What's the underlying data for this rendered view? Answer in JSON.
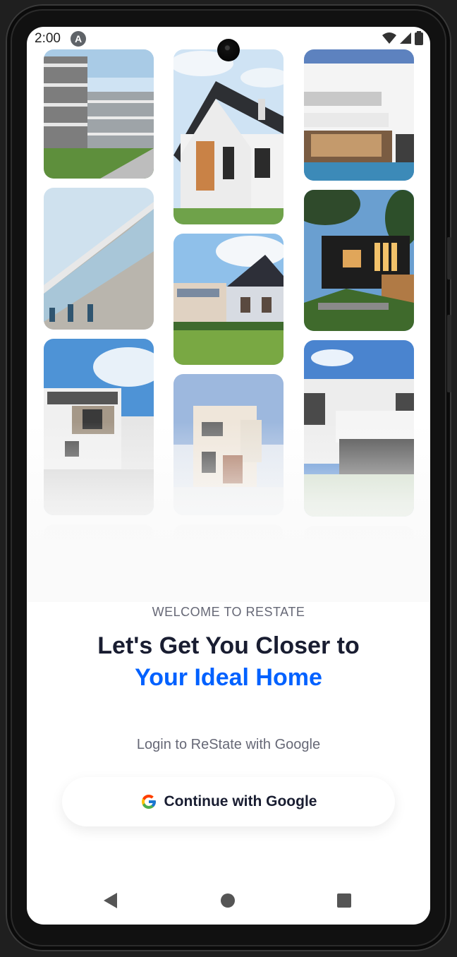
{
  "status_bar": {
    "time": "2:00",
    "app_badge": "A"
  },
  "gallery": {
    "images": [
      "apartment-block",
      "white-gable-house",
      "modern-villa-pool",
      "facade-angle",
      "wooden-porch-house",
      "black-box-house",
      "white-cube-house",
      "beige-townhouse",
      "glass-front-house"
    ]
  },
  "welcome": {
    "eyebrow": "WELCOME TO RESTATE",
    "headline_line1": "Let's Get You Closer to",
    "headline_line2": "Your Ideal Home",
    "login_prompt": "Login to ReState with Google",
    "google_button": "Continue with Google"
  },
  "colors": {
    "primary": "#0061ff",
    "text_dark": "#191d31",
    "text_muted": "#666876"
  }
}
